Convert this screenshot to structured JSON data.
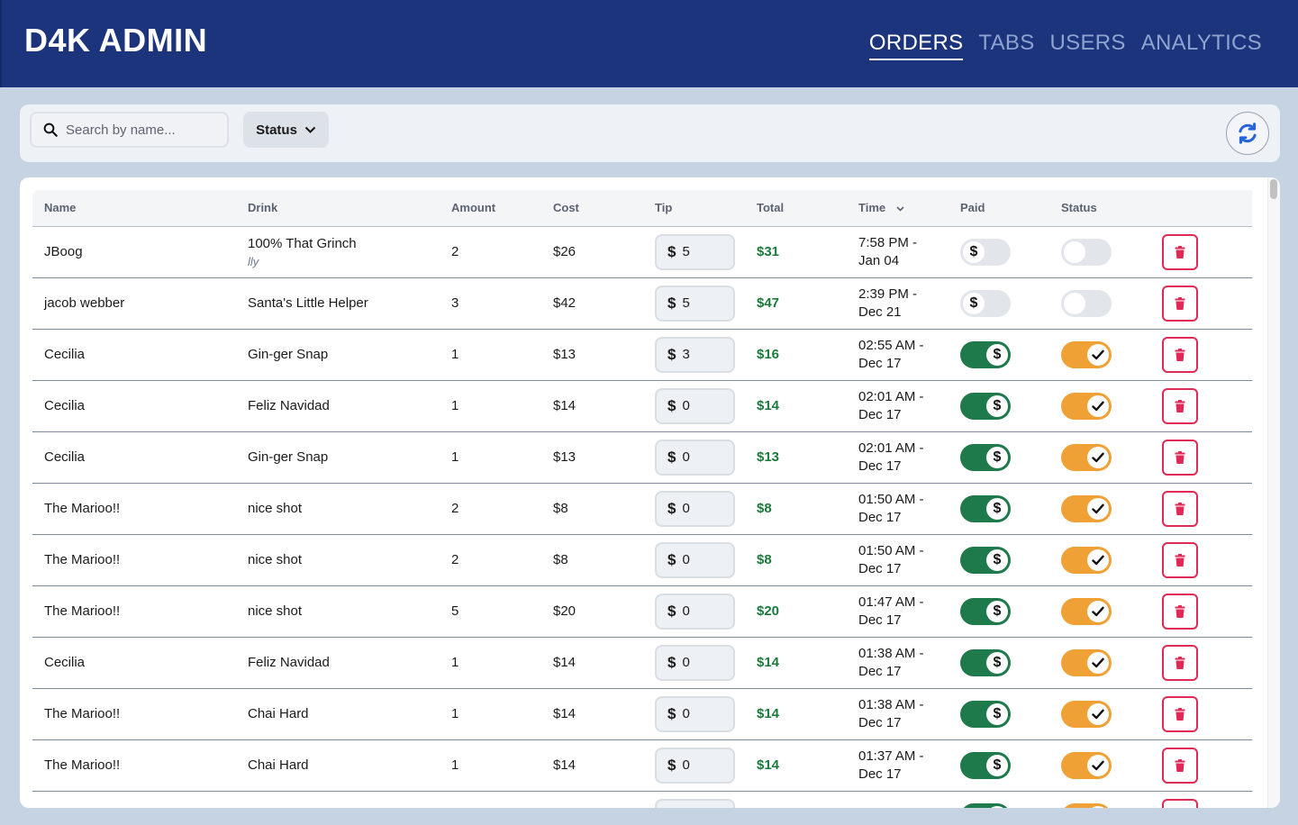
{
  "app": {
    "title": "D4K ADMIN"
  },
  "nav": [
    {
      "label": "ORDERS",
      "active": true
    },
    {
      "label": "TABS",
      "active": false
    },
    {
      "label": "USERS",
      "active": false
    },
    {
      "label": "ANALYTICS",
      "active": false
    }
  ],
  "toolbar": {
    "search_placeholder": "Search by name...",
    "status_label": "Status",
    "refresh_icon": "refresh-icon"
  },
  "table": {
    "headers": {
      "name": "Name",
      "drink": "Drink",
      "amount": "Amount",
      "cost": "Cost",
      "tip": "Tip",
      "total": "Total",
      "time": "Time",
      "paid": "Paid",
      "status": "Status"
    },
    "rows": [
      {
        "name": "JBoog",
        "drink": "100% That Grinch",
        "note": "lly",
        "amount": "2",
        "cost": "$26",
        "tip": "5",
        "total": "$31",
        "time1": "7:58 PM -",
        "time2": "Jan 04",
        "paid": false,
        "done": false
      },
      {
        "name": "jacob webber",
        "drink": "Santa's Little Helper",
        "note": "",
        "amount": "3",
        "cost": "$42",
        "tip": "5",
        "total": "$47",
        "time1": "2:39 PM -",
        "time2": "Dec 21",
        "paid": false,
        "done": false
      },
      {
        "name": "Cecilia",
        "drink": "Gin-ger Snap",
        "note": "",
        "amount": "1",
        "cost": "$13",
        "tip": "3",
        "total": "$16",
        "time1": "02:55 AM -",
        "time2": "Dec 17",
        "paid": true,
        "done": true
      },
      {
        "name": "Cecilia",
        "drink": "Feliz Navidad",
        "note": "",
        "amount": "1",
        "cost": "$14",
        "tip": "0",
        "total": "$14",
        "time1": "02:01 AM -",
        "time2": "Dec 17",
        "paid": true,
        "done": true
      },
      {
        "name": "Cecilia",
        "drink": "Gin-ger Snap",
        "note": "",
        "amount": "1",
        "cost": "$13",
        "tip": "0",
        "total": "$13",
        "time1": "02:01 AM -",
        "time2": "Dec 17",
        "paid": true,
        "done": true
      },
      {
        "name": "The Marioo!!",
        "drink": "nice shot",
        "note": "",
        "amount": "2",
        "cost": "$8",
        "tip": "0",
        "total": "$8",
        "time1": "01:50 AM -",
        "time2": "Dec 17",
        "paid": true,
        "done": true
      },
      {
        "name": "The Marioo!!",
        "drink": "nice shot",
        "note": "",
        "amount": "2",
        "cost": "$8",
        "tip": "0",
        "total": "$8",
        "time1": "01:50 AM -",
        "time2": "Dec 17",
        "paid": true,
        "done": true
      },
      {
        "name": "The Marioo!!",
        "drink": "nice shot",
        "note": "",
        "amount": "5",
        "cost": "$20",
        "tip": "0",
        "total": "$20",
        "time1": "01:47 AM -",
        "time2": "Dec 17",
        "paid": true,
        "done": true
      },
      {
        "name": "Cecilia",
        "drink": "Feliz Navidad",
        "note": "",
        "amount": "1",
        "cost": "$14",
        "tip": "0",
        "total": "$14",
        "time1": "01:38 AM -",
        "time2": "Dec 17",
        "paid": true,
        "done": true
      },
      {
        "name": "The Marioo!!",
        "drink": "Chai Hard",
        "note": "",
        "amount": "1",
        "cost": "$14",
        "tip": "0",
        "total": "$14",
        "time1": "01:38 AM -",
        "time2": "Dec 17",
        "paid": true,
        "done": true
      },
      {
        "name": "The Marioo!!",
        "drink": "Chai Hard",
        "note": "",
        "amount": "1",
        "cost": "$14",
        "tip": "0",
        "total": "$14",
        "time1": "01:37 AM -",
        "time2": "Dec 17",
        "paid": true,
        "done": true
      },
      {
        "name": "",
        "drink": "",
        "note": "",
        "amount": "",
        "cost": "",
        "tip": "",
        "total": "",
        "time1": "",
        "time2": "",
        "paid": true,
        "done": true
      }
    ]
  },
  "colors": {
    "header": "#1c347c",
    "paid_on": "#1e7a4a",
    "status_on": "#f0a135",
    "delete": "#e02a55",
    "total": "#1a7a3a"
  },
  "icons": {
    "tip_currency": "$",
    "paid_knob": "$"
  }
}
